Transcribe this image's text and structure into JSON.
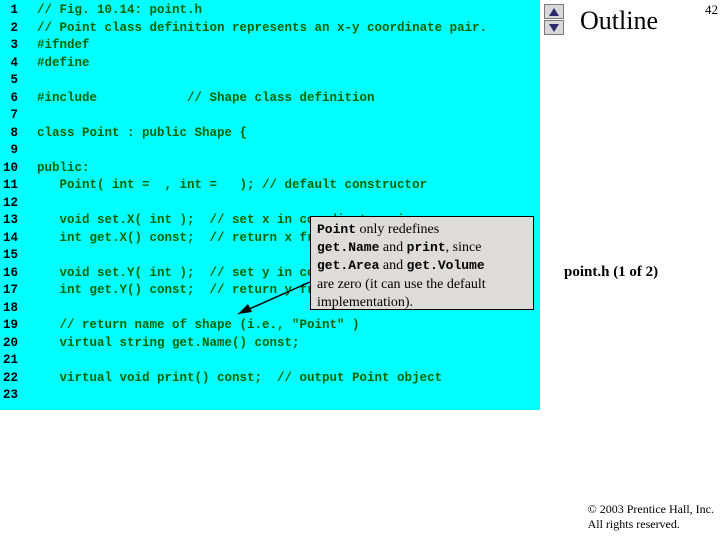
{
  "sidebar": {
    "outline": "Outline",
    "page_number": "42",
    "file_label": "point.h (1 of 2)",
    "copyright_line1": "© 2003 Prentice Hall, Inc.",
    "copyright_line2": "All rights reserved."
  },
  "callout": {
    "l1a": "Point",
    "l1b": " only redefines",
    "l2a": "get.Name",
    "l2b": " and ",
    "l2c": "print",
    "l2d": ", since",
    "l3a": "get.Area",
    "l3b": " and ",
    "l3c": "get.Volume",
    "l4": "are zero (it can use the default",
    "l5": "implementation)."
  },
  "code": [
    {
      "n": "1",
      "t": "// Fig. 10.14: point.h"
    },
    {
      "n": "2",
      "t": "// Point class definition represents an x-y coordinate pair."
    },
    {
      "n": "3",
      "t": "#ifndef"
    },
    {
      "n": "4",
      "t": "#define"
    },
    {
      "n": "5",
      "t": ""
    },
    {
      "n": "6",
      "t": "#include            // Shape class definition"
    },
    {
      "n": "7",
      "t": ""
    },
    {
      "n": "8",
      "t": "class Point : public Shape {"
    },
    {
      "n": "9",
      "t": ""
    },
    {
      "n": "10",
      "t": "public:"
    },
    {
      "n": "11",
      "t": "   Point( int =  , int =   ); // default constructor"
    },
    {
      "n": "12",
      "t": ""
    },
    {
      "n": "13",
      "t": "   void set.X( int );  // set x in coordinate pair"
    },
    {
      "n": "14",
      "t": "   int get.X() const;  // return x from coordinate pair"
    },
    {
      "n": "15",
      "t": ""
    },
    {
      "n": "16",
      "t": "   void set.Y( int );  // set y in coordinate pair"
    },
    {
      "n": "17",
      "t": "   int get.Y() const;  // return y from coordinate pair"
    },
    {
      "n": "18",
      "t": ""
    },
    {
      "n": "19",
      "t": "   // return name of shape (i.e., \"Point\" )"
    },
    {
      "n": "20",
      "t": "   virtual string get.Name() const;"
    },
    {
      "n": "21",
      "t": ""
    },
    {
      "n": "22",
      "t": "   virtual void print() const;  // output Point object"
    },
    {
      "n": "23",
      "t": ""
    }
  ]
}
